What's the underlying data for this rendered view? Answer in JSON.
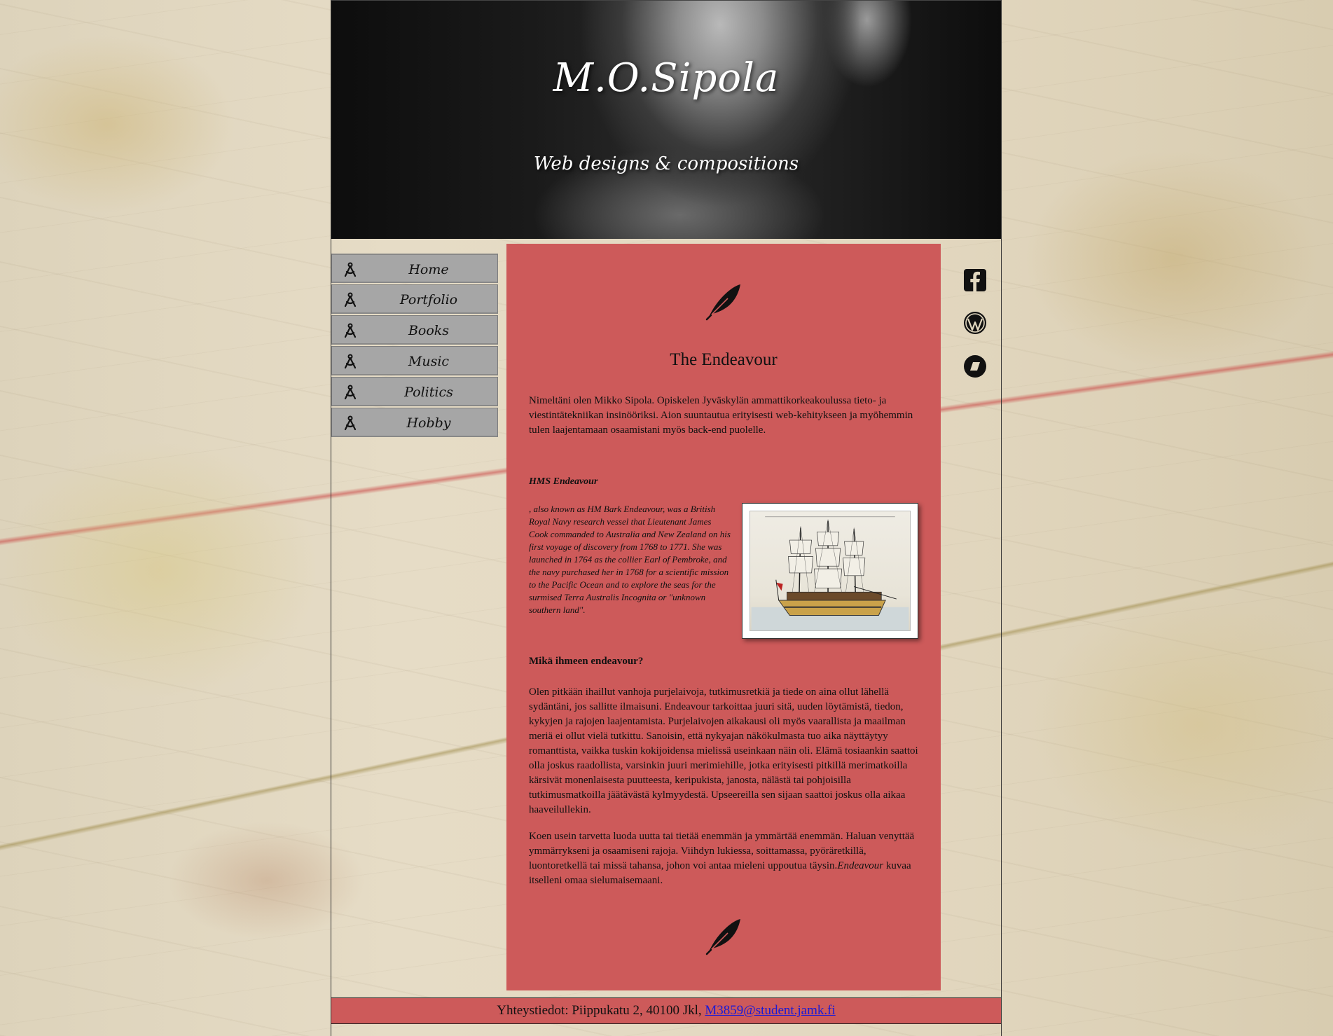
{
  "header": {
    "title": "M.O.Sipola",
    "subtitle": "Web designs & compositions"
  },
  "nav": {
    "items": [
      {
        "label": "Home",
        "icon": "compass-icon"
      },
      {
        "label": "Portfolio",
        "icon": "compass-icon"
      },
      {
        "label": "Books",
        "icon": "compass-icon"
      },
      {
        "label": "Music",
        "icon": "compass-icon"
      },
      {
        "label": "Politics",
        "icon": "compass-icon"
      },
      {
        "label": "Hobby",
        "icon": "compass-icon"
      }
    ]
  },
  "main": {
    "title": "The Endeavour",
    "intro": "Nimeltäni olen Mikko Sipola. Opiskelen Jyväskylän ammattikorkeakoulussa tieto- ja viestintätekniikan insinööriksi. Aion suuntautua erityisesti web-kehitykseen ja myöhemmin tulen laajentamaan osaamistani myös back-end puolelle.",
    "hms_heading": "HMS Endeavour",
    "hms_text": ", also known as HM Bark Endeavour, was a British Royal Navy research vessel that Lieutenant James Cook commanded to Australia and New Zealand on his first voyage of discovery from 1768 to 1771. She was launched in 1764 as the collier Earl of Pembroke, and the navy purchased her in 1768 for a scientific mission to the Pacific Ocean and to explore the seas for the surmised Terra Australis Incognita or \"unknown southern land\".",
    "question": "Mikä ihmeen endeavour?",
    "para1": "Olen pitkään ihaillut vanhoja purjelaivoja, tutkimusretkiä ja tiede on aina ollut lähellä sydäntäni, jos sallitte ilmaisuni. Endeavour tarkoittaa juuri sitä, uuden löytämistä, tiedon, kykyjen ja rajojen laajentamista. Purjelaivojen aikakausi oli myös vaarallista ja maailman meriä ei ollut vielä tutkittu. Sanoisin, että nykyajan näkökulmasta tuo aika näyttäytyy romanttista, vaikka tuskin kokijoidensa mielissä useinkaan näin oli. Elämä tosiaankin saattoi olla joskus raadollista, varsinkin juuri merimiehille, jotka erityisesti pitkillä merimatkoilla kärsivät monenlaisesta puutteesta, keripukista, janosta, nälästä tai pohjoisilla tutkimusmatkoilla jäätävästä kylmyydestä. Upseereilla sen sijaan saattoi joskus olla aikaa haaveilullekin.",
    "para2_start": "Koen usein tarvetta luoda uutta tai tietää enemmän ja ymmärtää enemmän. Haluan venyttää ymmärrykseni ja osaamiseni rajoja. Viihdyn lukiessa, soittamassa, pyöräretkillä, luontoretkellä tai missä tahansa, johon voi antaa mieleni uppoutua täysin.",
    "para2_em": "Endeavour",
    "para2_end": " kuvaa itselleni omaa sielumaisemaani."
  },
  "social": [
    {
      "name": "facebook-icon"
    },
    {
      "name": "wordpress-icon"
    },
    {
      "name": "behance-icon"
    }
  ],
  "footer": {
    "text": "Yhteystiedot: Piippukatu 2, 40100 Jkl, ",
    "email": "M3859@student.jamk.fi"
  },
  "colors": {
    "content_bg": "#cd5a5a",
    "nav_bg": "#a6a6a6",
    "link": "#1a1ad6"
  }
}
